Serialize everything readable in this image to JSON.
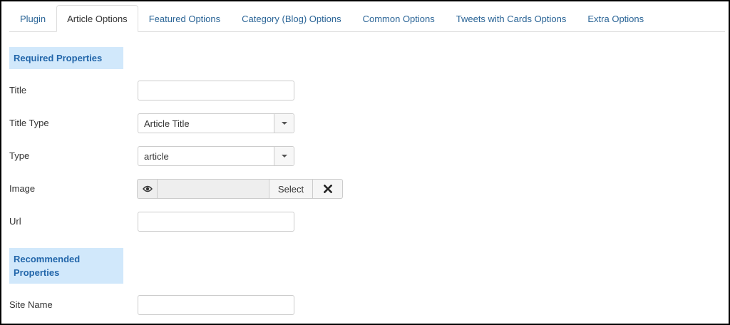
{
  "tabs": [
    {
      "label": "Plugin",
      "active": false
    },
    {
      "label": "Article Options",
      "active": true
    },
    {
      "label": "Featured Options",
      "active": false
    },
    {
      "label": "Category (Blog) Options",
      "active": false
    },
    {
      "label": "Common Options",
      "active": false
    },
    {
      "label": "Tweets with Cards Options",
      "active": false
    },
    {
      "label": "Extra Options",
      "active": false
    }
  ],
  "sections": {
    "required": {
      "label": "Required Properties"
    },
    "recommended": {
      "label": "Recommended Properties"
    }
  },
  "fields": {
    "title": {
      "label": "Title",
      "value": ""
    },
    "title_type": {
      "label": "Title Type",
      "value": "Article Title"
    },
    "type": {
      "label": "Type",
      "value": "article"
    },
    "image": {
      "label": "Image",
      "value": "",
      "select_label": "Select",
      "preview_icon": "eye-icon",
      "clear_icon": "close-icon"
    },
    "url": {
      "label": "Url",
      "value": ""
    },
    "site_name": {
      "label": "Site Name",
      "value": ""
    }
  },
  "colors": {
    "link": "#2a6496",
    "section_bg": "#d1e8fb",
    "section_text": "#2266aa"
  }
}
